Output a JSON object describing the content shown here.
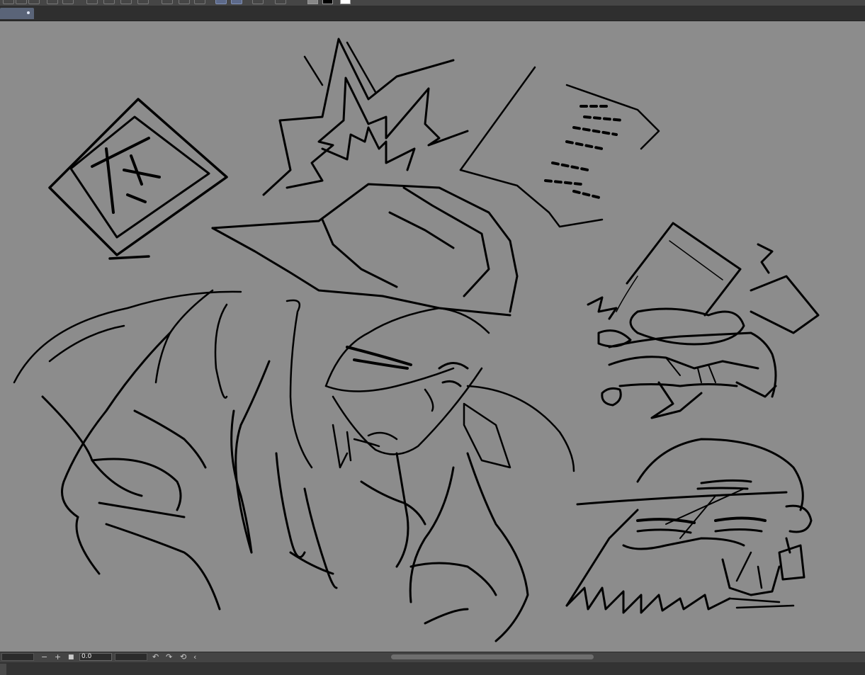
{
  "toolbar": {
    "tools": [
      "new-icon",
      "open-icon",
      "save-icon",
      "undo-icon",
      "redo-icon",
      "brush-size-icon",
      "blur-icon",
      "fill-icon",
      "transform-icon",
      "select-rect-icon",
      "select-lasso-icon",
      "select-all-icon",
      "ruler-icon",
      "pen-icon"
    ],
    "active_tools": [
      "select-rect-icon",
      "select-lasso-icon"
    ],
    "colors": {
      "main": "#000000",
      "sub": "#ffffff",
      "accent": "#5d6a8a"
    }
  },
  "document_tab": {
    "active": true
  },
  "statusbar": {
    "zoom_minus": "−",
    "zoom_plus": "+",
    "zoom_value": "0.0",
    "rotate_left_icon": "↶",
    "rotate_right_icon": "↷",
    "reset_icon": "⟲",
    "collapse_icon": "‹"
  },
  "canvas": {
    "background": "#8c8c8c",
    "stroke": "#000000"
  }
}
